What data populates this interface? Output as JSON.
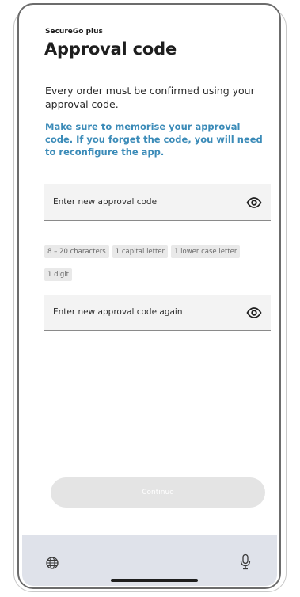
{
  "app": {
    "name": "SecureGo plus"
  },
  "page": {
    "title": "Approval code",
    "intro": "Every order must be confirmed using your approval code.",
    "warning": "Make sure to memorise your approval code. If you forget the code, you will need to reconfigure the app."
  },
  "form": {
    "new_code_placeholder": "Enter new approval code",
    "repeat_code_placeholder": "Enter new approval code again",
    "rules": [
      "8 – 20 characters",
      "1 capital letter",
      "1 lower case letter",
      "1 digit"
    ],
    "continue_label": "Continue"
  },
  "icons": {
    "show_password": "eye-icon",
    "keyboard_language": "globe-icon",
    "dictation": "microphone-icon"
  },
  "colors": {
    "accent": "#3b8bb8",
    "button_disabled": "#e4e4e4",
    "keyboard_bar": "#dfe2ea"
  }
}
